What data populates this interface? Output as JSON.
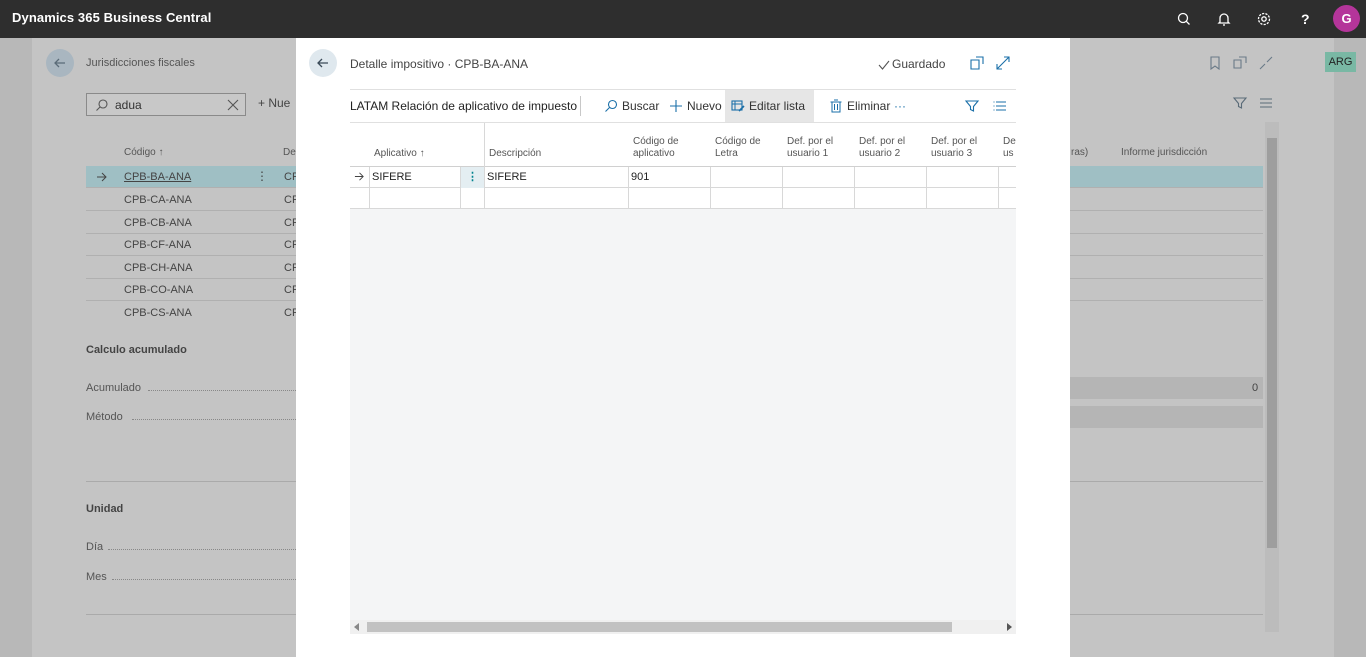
{
  "app": {
    "title": "Dynamics 365 Business Central",
    "avatar_initial": "G"
  },
  "topbar_icons": [
    "search-icon",
    "bell-icon",
    "gear-icon",
    "help-icon"
  ],
  "background": {
    "title": "Jurisdicciones fiscales",
    "search_value": "adua",
    "new_label": "+ Nue",
    "col_code": "Código ↑",
    "col_desc": "De",
    "col_purchases": "ras)",
    "col_report": "Informe jurisdicción",
    "rows": [
      {
        "code": "CPB-BA-ANA",
        "desc": "CP"
      },
      {
        "code": "CPB-CA-ANA",
        "desc": "CP"
      },
      {
        "code": "CPB-CB-ANA",
        "desc": "CP"
      },
      {
        "code": "CPB-CF-ANA",
        "desc": "CP"
      },
      {
        "code": "CPB-CH-ANA",
        "desc": "CP"
      },
      {
        "code": "CPB-CO-ANA",
        "desc": "CP"
      },
      {
        "code": "CPB-CS-ANA",
        "desc": "CP"
      }
    ],
    "section_calc": "Calculo acumulado",
    "field_acumulado": "Acumulado",
    "acumulado_value": "0",
    "field_metodo": "Método",
    "section_unidad": "Unidad",
    "field_dia": "Día",
    "field_mes": "Mes",
    "badge": "ARG"
  },
  "modal": {
    "title": "Detalle impositivo · CPB-BA-ANA",
    "saved": "Guardado",
    "caption": "LATAM Relación de aplicativo de impuesto",
    "actions": {
      "search": "Buscar",
      "new": "Nuevo",
      "edit_list": "Editar lista",
      "delete": "Eliminar",
      "more": "···"
    },
    "columns": {
      "aplicativo": "Aplicativo ↑",
      "descripcion": "Descripción",
      "codigo_aplicativo_1": "Código de",
      "codigo_aplicativo_2": "aplicativo",
      "codigo_letra_1": "Código de",
      "codigo_letra_2": "Letra",
      "def1_1": "Def. por el",
      "def1_2": "usuario 1",
      "def2_1": "Def. por el",
      "def2_2": "usuario 2",
      "def3_1": "Def. por el",
      "def3_2": "usuario 3",
      "def4_1": "De",
      "def4_2": "us"
    },
    "rows": [
      {
        "aplicativo": "SIFERE",
        "descripcion": "SIFERE",
        "codigo": "901",
        "letra": "",
        "u1": "",
        "u2": "",
        "u3": ""
      }
    ]
  }
}
